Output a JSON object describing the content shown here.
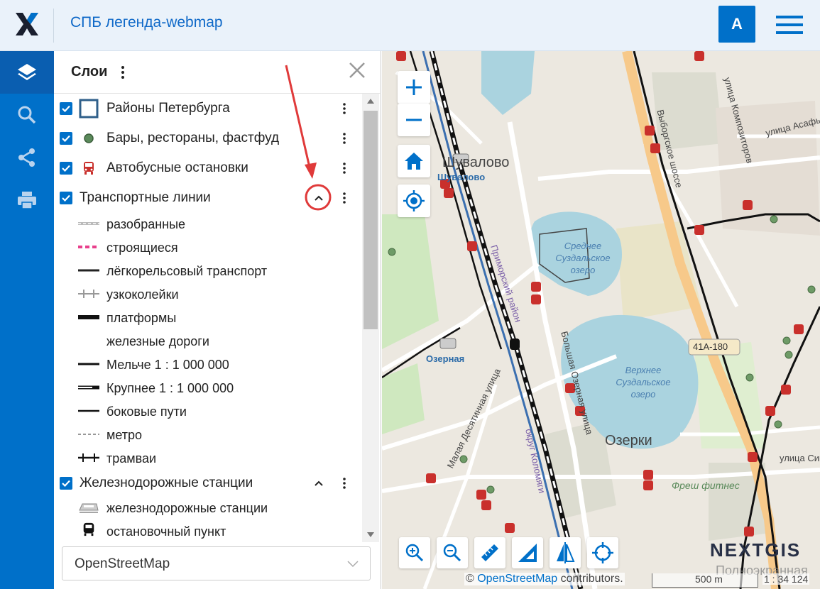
{
  "header": {
    "title": "СПБ легенда-webmap",
    "avatar_letter": "A"
  },
  "panel": {
    "title": "Слои",
    "layers": [
      {
        "label": "Районы Петербурга",
        "checked": true
      },
      {
        "label": "Бары, рестораны, фастфуд",
        "checked": true
      },
      {
        "label": "Автобусные остановки",
        "checked": true
      },
      {
        "label": "Транспортные линии",
        "checked": true,
        "expanded": true
      },
      {
        "label": "Железнодорожные станции",
        "checked": true,
        "expanded": true
      }
    ],
    "transport_legend": [
      "разобранные",
      "строящиеся",
      "лёгкорельсовый транспорт",
      "узкоколейки",
      "платформы",
      "железные дороги",
      "Мельче 1 : 1 000 000",
      "Крупнее 1 : 1 000 000",
      "боковые пути",
      "метро",
      "трамваи"
    ],
    "rail_legend": [
      "железнодорожные станции",
      "остановочный пункт"
    ],
    "basemap": "OpenStreetMap"
  },
  "map": {
    "labels": {
      "shuvalovo": "Шувалово",
      "shuvalovo_st": "Шувалово",
      "ozernaya": "Озерная",
      "ozerki": "Озерки",
      "lake1": "Среднее Суздальское озеро",
      "lake2": "Верхнее Суздальское озеро",
      "vyborgskoe": "Выборгское шоссе",
      "bolshaya": "Большая Озерная улица",
      "malaya": "Малая Десятинная улица",
      "kolomyagi": "округ Коломяги",
      "asafyeva": "улица Асафьева",
      "route": "41А-180",
      "fitness": "Фреш фитнес",
      "sikeyrosa": "улица Сике",
      "rayon": "Приморский район",
      "kompozitorov": "улица Композиторов"
    },
    "attribution_prefix": "© ",
    "attribution_link": "OpenStreetMap",
    "attribution_suffix": " contributors.",
    "scale_label": "500 m",
    "scale_ratio": "1 : 34 124",
    "brand": "NEXTGIS",
    "fullscreen_hint": "Полноэкранная"
  },
  "colors": {
    "accent": "#0070c9",
    "annotation": "#e03a3a"
  }
}
